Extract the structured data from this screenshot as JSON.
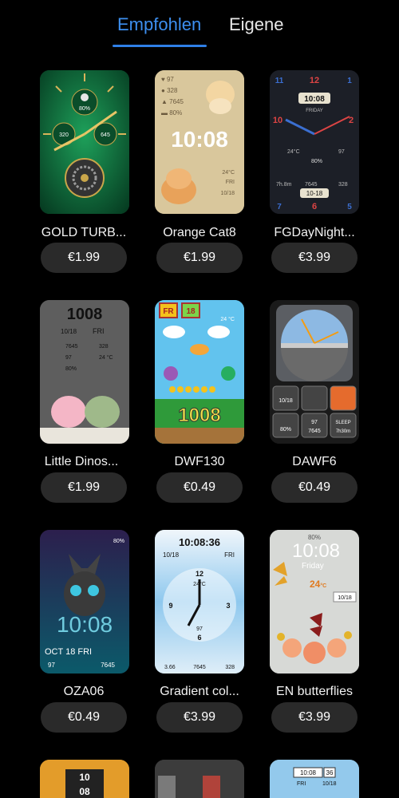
{
  "tabs": {
    "recommended": "Empfohlen",
    "own": "Eigene"
  },
  "items": [
    {
      "name": "GOLD TURB...",
      "price": "€1.99",
      "face": {
        "battery": "80%",
        "left": "320",
        "right": "645"
      }
    },
    {
      "name": "Orange Cat8",
      "price": "€1.99",
      "face": {
        "stat1": "97",
        "stat2": "328",
        "stat3": "7645",
        "stat4": "80%",
        "time": "10:08",
        "temp": "24°C",
        "day": "FRI",
        "date": "10/18"
      }
    },
    {
      "name": "FGDayNight...",
      "price": "€3.99",
      "face": {
        "time": "10:08",
        "day": "FRIDAY",
        "temp": "24°C",
        "battery": "80%",
        "heart": "97",
        "steps": "7645",
        "kcal": "328",
        "date": "10-18",
        "steps_km": "7h.8m"
      }
    },
    {
      "name": "Little Dinos...",
      "price": "€1.99",
      "face": {
        "time": "1008",
        "date": "10/18",
        "day": "FRI",
        "steps": "7645",
        "kcal": "328",
        "heart": "97",
        "temp": "24",
        "temp_unit": "°C",
        "battery": "80%"
      }
    },
    {
      "name": "DWF130",
      "price": "€0.49",
      "face": {
        "fr": "FR",
        "date": "18",
        "time": "1008",
        "temp": "24 °C"
      }
    },
    {
      "name": "DAWF6",
      "price": "€0.49",
      "face": {
        "date": "10/18",
        "battery": "80%",
        "heart": "97",
        "steps": "7645",
        "sleep": "SLEEP",
        "sleep_time": "7h30m"
      }
    },
    {
      "name": "OZA06",
      "price": "€0.49",
      "face": {
        "battery": "80%",
        "time": "10:08",
        "date": "OCT 18 FRI",
        "heart": "97",
        "steps": "7645"
      }
    },
    {
      "name": "Gradient col...",
      "price": "€3.99",
      "face": {
        "time": "10:08:36",
        "date": "10/18",
        "day": "FRI",
        "temp": "24°C",
        "heart": "97",
        "dist": "3.66",
        "steps": "7645",
        "kcal": "328"
      }
    },
    {
      "name": "EN butterflies",
      "price": "€3.99",
      "face": {
        "battery": "80%",
        "time": "10:08",
        "day": "Friday",
        "temp": "24",
        "temp_unit": "°C",
        "date": "10/18"
      }
    }
  ],
  "partial": {
    "time1": "10",
    "time2": "08",
    "date_time": "10:08",
    "date_num": "36",
    "day": "FRI",
    "date": "10/18"
  }
}
